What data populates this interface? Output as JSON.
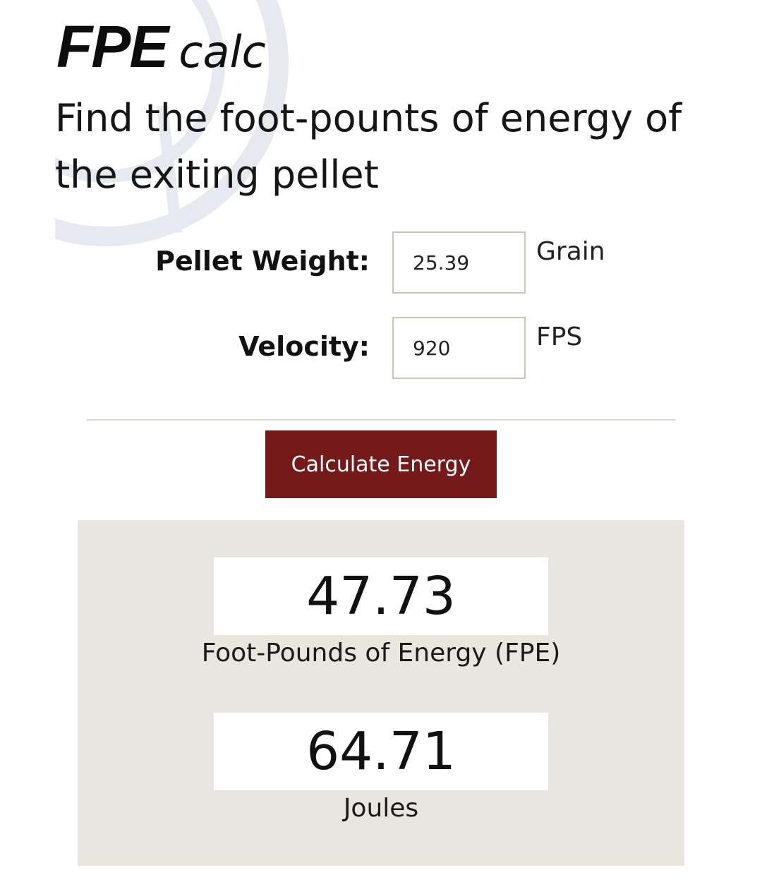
{
  "header": {
    "logo_bold": "FPE",
    "logo_light": "calc",
    "subtitle": "Find the foot-pounts of energy of the exiting pellet"
  },
  "form": {
    "pellet_weight": {
      "label": "Pellet Weight:",
      "value": "25.39",
      "unit": "Grain"
    },
    "velocity": {
      "label": "Velocity:",
      "value": "920",
      "unit": "FPS"
    }
  },
  "button": {
    "label": "Calculate Energy"
  },
  "results": {
    "fpe": {
      "value": "47.73",
      "label": "Foot-Pounds of Energy (FPE)"
    },
    "joules": {
      "value": "64.71",
      "label": "Joules"
    }
  },
  "colors": {
    "button_bg": "#751a1b",
    "results_bg": "#e9e6e0",
    "input_border": "#c9c6b5",
    "watermark": "#e6eaf0"
  }
}
